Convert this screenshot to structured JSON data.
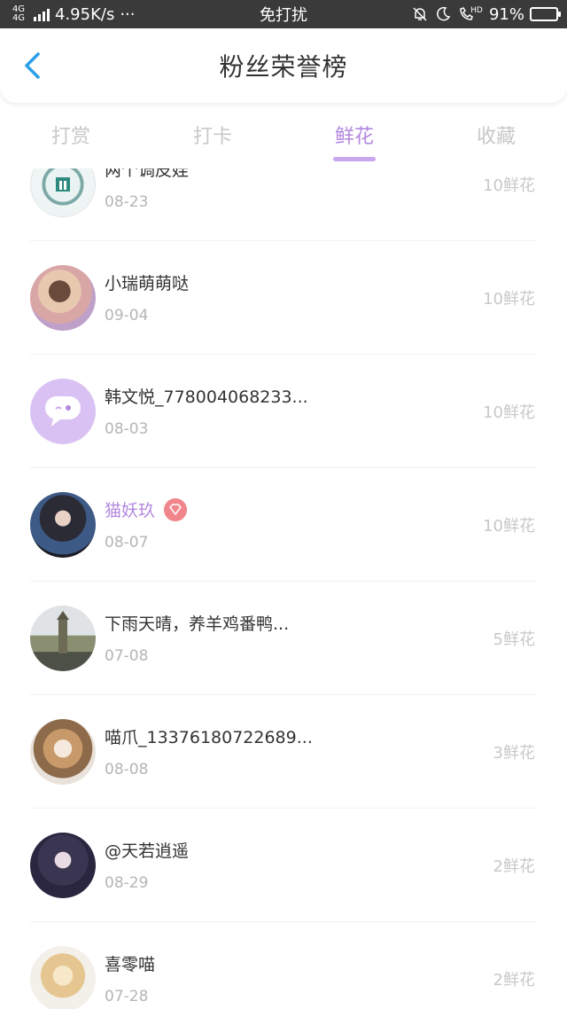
{
  "status_bar": {
    "network_type": "4G 4G",
    "speed": "4.95K/s",
    "dots": "···",
    "center_text": "免打扰",
    "hd_label": "HD",
    "battery_percent": "91%",
    "battery_level": 0.91,
    "battery_color": "#4cd964"
  },
  "header": {
    "title": "粉丝荣誉榜",
    "back_icon": "chevron-left-icon",
    "accent_color": "#2a9fe6"
  },
  "tabs": [
    {
      "label": "打赏",
      "active": false
    },
    {
      "label": "打卡",
      "active": false
    },
    {
      "label": "鲜花",
      "active": true
    },
    {
      "label": "收藏",
      "active": false
    }
  ],
  "accent_color": "#b388e0",
  "list": [
    {
      "name": "两个调皮娃",
      "date": "08-23",
      "flowers": "10鲜花",
      "vip": false
    },
    {
      "name": "小瑞萌萌哒",
      "date": "09-04",
      "flowers": "10鲜花",
      "vip": false
    },
    {
      "name": "韩文悦_778004068233...",
      "date": "08-03",
      "flowers": "10鲜花",
      "vip": false
    },
    {
      "name": "猫妖玖",
      "date": "08-07",
      "flowers": "10鲜花",
      "vip": true
    },
    {
      "name": "下雨天晴，养羊鸡番鸭...",
      "date": "07-08",
      "flowers": "5鲜花",
      "vip": false
    },
    {
      "name": "喵爪_13376180722689...",
      "date": "08-08",
      "flowers": "3鲜花",
      "vip": false
    },
    {
      "name": "@天若逍遥",
      "date": "08-29",
      "flowers": "2鲜花",
      "vip": false
    },
    {
      "name": "喜零喵",
      "date": "07-28",
      "flowers": "2鲜花",
      "vip": false
    }
  ]
}
